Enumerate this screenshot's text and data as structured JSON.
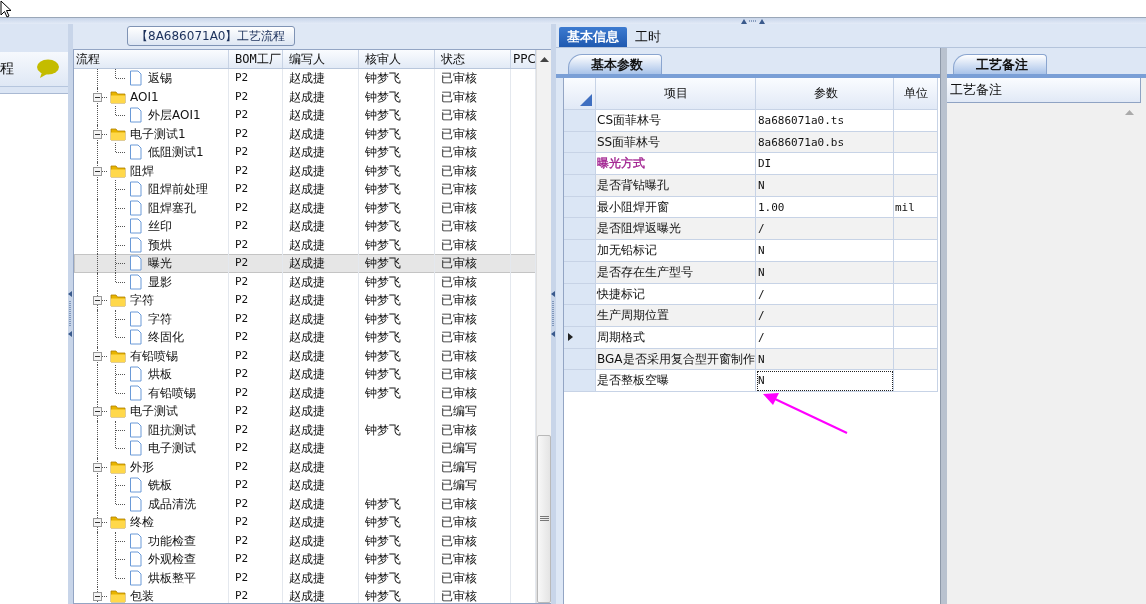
{
  "left_panel": {
    "label": "程"
  },
  "process_panel": {
    "title": "【8A686071A0】工艺流程",
    "columns": [
      "流程",
      "BOM工厂",
      "编写人",
      "核审人",
      "状态",
      "PPC"
    ],
    "tree": [
      {
        "children": [
          {
            "name": "返锡",
            "bom": "P2",
            "writer": "赵成捷",
            "reviewer": "钟梦飞",
            "status": "已审核",
            "selected": false
          }
        ]
      },
      {
        "name": "AOI1",
        "bom": "P2",
        "writer": "赵成捷",
        "reviewer": "钟梦飞",
        "status": "已审核",
        "selected": false,
        "expanded": true,
        "children": [
          {
            "name": "外层AOI1",
            "bom": "P2",
            "writer": "赵成捷",
            "reviewer": "钟梦飞",
            "status": "已审核",
            "selected": false
          }
        ]
      },
      {
        "name": "电子测试1",
        "bom": "P2",
        "writer": "赵成捷",
        "reviewer": "钟梦飞",
        "status": "已审核",
        "selected": false,
        "expanded": true,
        "children": [
          {
            "name": "低阻测试1",
            "bom": "P2",
            "writer": "赵成捷",
            "reviewer": "钟梦飞",
            "status": "已审核",
            "selected": false
          }
        ]
      },
      {
        "name": "阻焊",
        "bom": "P2",
        "writer": "赵成捷",
        "reviewer": "钟梦飞",
        "status": "已审核",
        "selected": false,
        "expanded": true,
        "children": [
          {
            "name": "阻焊前处理",
            "bom": "P2",
            "writer": "赵成捷",
            "reviewer": "钟梦飞",
            "status": "已审核",
            "selected": false
          },
          {
            "name": "阻焊塞孔",
            "bom": "P2",
            "writer": "赵成捷",
            "reviewer": "钟梦飞",
            "status": "已审核",
            "selected": false
          },
          {
            "name": "丝印",
            "bom": "P2",
            "writer": "赵成捷",
            "reviewer": "钟梦飞",
            "status": "已审核",
            "selected": false
          },
          {
            "name": "预烘",
            "bom": "P2",
            "writer": "赵成捷",
            "reviewer": "钟梦飞",
            "status": "已审核",
            "selected": false
          },
          {
            "name": "曝光",
            "bom": "P2",
            "writer": "赵成捷",
            "reviewer": "钟梦飞",
            "status": "已审核",
            "selected": true
          },
          {
            "name": "显影",
            "bom": "P2",
            "writer": "赵成捷",
            "reviewer": "钟梦飞",
            "status": "已审核",
            "selected": false
          }
        ]
      },
      {
        "name": "字符",
        "bom": "P2",
        "writer": "赵成捷",
        "reviewer": "钟梦飞",
        "status": "已审核",
        "selected": false,
        "expanded": true,
        "children": [
          {
            "name": "字符",
            "bom": "P2",
            "writer": "赵成捷",
            "reviewer": "钟梦飞",
            "status": "已审核",
            "selected": false
          },
          {
            "name": "终固化",
            "bom": "P2",
            "writer": "赵成捷",
            "reviewer": "钟梦飞",
            "status": "已审核",
            "selected": false
          }
        ]
      },
      {
        "name": "有铅喷锡",
        "bom": "P2",
        "writer": "赵成捷",
        "reviewer": "钟梦飞",
        "status": "已审核",
        "selected": false,
        "expanded": true,
        "children": [
          {
            "name": "烘板",
            "bom": "P2",
            "writer": "赵成捷",
            "reviewer": "钟梦飞",
            "status": "已审核",
            "selected": false
          },
          {
            "name": "有铅喷锡",
            "bom": "P2",
            "writer": "赵成捷",
            "reviewer": "钟梦飞",
            "status": "已审核",
            "selected": false
          }
        ]
      },
      {
        "name": "电子测试",
        "bom": "P2",
        "writer": "赵成捷",
        "status": "已编写",
        "selected": false,
        "expanded": true,
        "children": [
          {
            "name": "阻抗测试",
            "bom": "P2",
            "writer": "赵成捷",
            "reviewer": "钟梦飞",
            "status": "已审核",
            "selected": false
          },
          {
            "name": "电子测试",
            "bom": "P2",
            "writer": "赵成捷",
            "status": "已编写",
            "selected": false
          }
        ]
      },
      {
        "name": "外形",
        "bom": "P2",
        "writer": "赵成捷",
        "status": "已编写",
        "selected": false,
        "expanded": true,
        "children": [
          {
            "name": "铣板",
            "bom": "P2",
            "writer": "赵成捷",
            "status": "已编写",
            "selected": false
          },
          {
            "name": "成品清洗",
            "bom": "P2",
            "writer": "赵成捷",
            "reviewer": "钟梦飞",
            "status": "已审核",
            "selected": false
          }
        ]
      },
      {
        "name": "终检",
        "bom": "P2",
        "writer": "赵成捷",
        "reviewer": "钟梦飞",
        "status": "已审核",
        "selected": false,
        "expanded": true,
        "children": [
          {
            "name": "功能检查",
            "bom": "P2",
            "writer": "赵成捷",
            "reviewer": "钟梦飞",
            "status": "已审核",
            "selected": false
          },
          {
            "name": "外观检查",
            "bom": "P2",
            "writer": "赵成捷",
            "reviewer": "钟梦飞",
            "status": "已审核",
            "selected": false
          },
          {
            "name": "烘板整平",
            "bom": "P2",
            "writer": "赵成捷",
            "reviewer": "钟梦飞",
            "status": "已审核",
            "selected": false
          }
        ]
      },
      {
        "name": "包装",
        "bom": "P2",
        "writer": "赵成捷",
        "reviewer": "钟梦飞",
        "status": "已审核",
        "selected": false,
        "expanded": true
      }
    ]
  },
  "detail_panel": {
    "tabs": [
      {
        "label": "基本信息",
        "selected": true
      },
      {
        "label": "工时",
        "selected": false
      }
    ],
    "params": {
      "tab": "基本参数",
      "columns": [
        "项目",
        "参数",
        "单位"
      ],
      "rows": [
        {
          "item": "CS面菲林号",
          "value": "8a686071a0.ts",
          "current": false,
          "focused": false
        },
        {
          "item": "SS面菲林号",
          "value": "8a686071a0.bs",
          "current": false,
          "focused": false
        },
        {
          "item": "曝光方式",
          "value": "DI",
          "color": "#a0208f",
          "current": false,
          "focused": false
        },
        {
          "item": "是否背钻曝孔",
          "value": "N",
          "current": false,
          "focused": false
        },
        {
          "item": "最小阻焊开窗",
          "value": "1.00",
          "unit": "mil",
          "current": false,
          "focused": false
        },
        {
          "item": "是否阻焊返曝光",
          "value": "/",
          "current": false,
          "focused": false
        },
        {
          "item": "加无铅标记",
          "value": "N",
          "current": false,
          "focused": false
        },
        {
          "item": "是否存在生产型号",
          "value": "N",
          "current": false,
          "focused": false
        },
        {
          "item": "快捷标记",
          "value": "/",
          "current": false,
          "focused": false
        },
        {
          "item": "生产周期位置",
          "value": "/",
          "current": false,
          "focused": false
        },
        {
          "item": "周期格式",
          "value": "/",
          "current": true,
          "focused": false
        },
        {
          "item": "BGA是否采用复合型开窗制作",
          "value": "N",
          "current": false,
          "focused": false
        },
        {
          "item": "是否整板空曝",
          "value": "N",
          "current": false,
          "focused": true
        }
      ]
    },
    "notes": {
      "tab": "工艺备注",
      "column": "工艺备注"
    }
  }
}
